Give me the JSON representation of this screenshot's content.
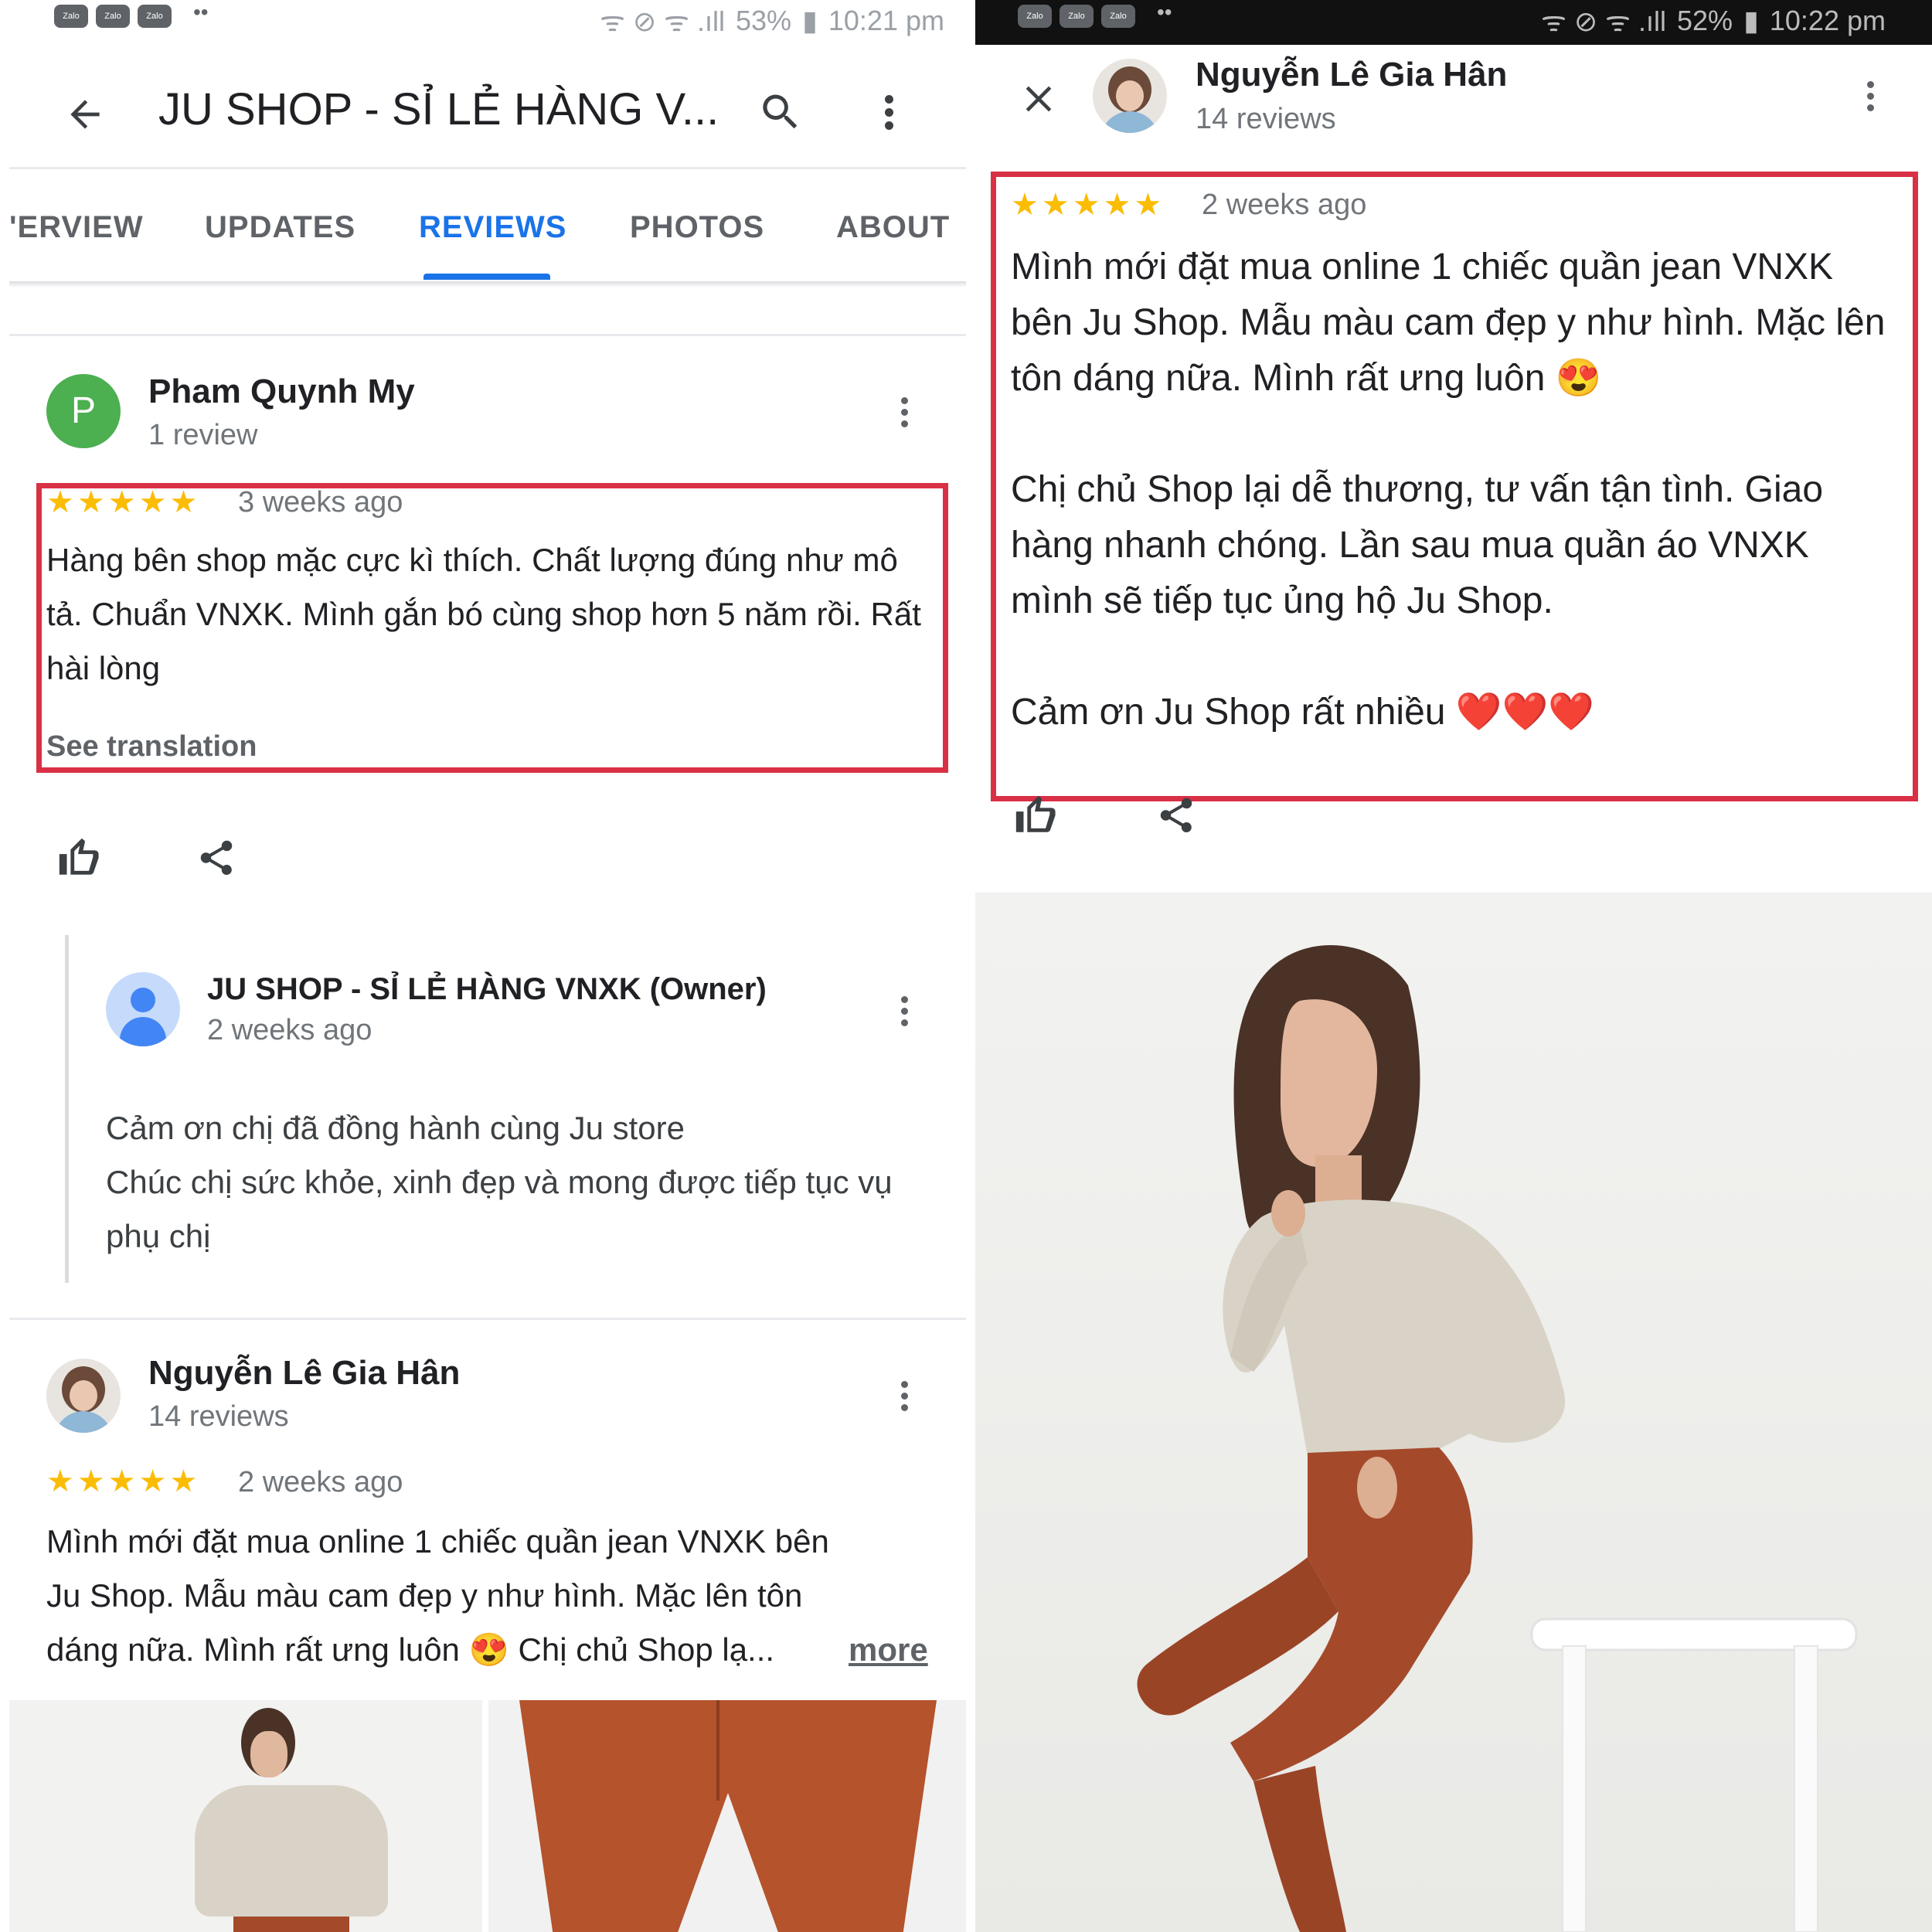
{
  "left": {
    "status": {
      "apps": [
        "Zalo",
        "Zalo",
        "Zalo"
      ],
      "indicators": "ᯤ ⊘ ᯤ .ıll",
      "battery": "53%",
      "time": "10:21 pm"
    },
    "appbar": {
      "title": "JU SHOP - SỈ LẺ HÀNG V..."
    },
    "tabs": [
      {
        "label": "'ERVIEW"
      },
      {
        "label": "UPDATES"
      },
      {
        "label": "REVIEWS"
      },
      {
        "label": "PHOTOS"
      },
      {
        "label": "ABOUT"
      }
    ],
    "active_tab": "REVIEWS",
    "review1": {
      "avatar_letter": "P",
      "author": "Pham Quynh My",
      "count": "1 review",
      "stars": "★★★★★",
      "time": "3 weeks ago",
      "text": "Hàng bên shop mặc cực kì thích. Chất lượng đúng như mô tả. Chuẩn VNXK. Mình gắn bó cùng shop hơn 5 năm rồi. Rất hài lòng",
      "translate": "See translation"
    },
    "owner_reply": {
      "author": "JU SHOP - SỈ LẺ HÀNG VNXK (Owner)",
      "time": "2 weeks ago",
      "text": "Cảm ơn chị đã đồng hành cùng Ju store\nChúc chị sức khỏe, xinh đẹp và mong được tiếp tục vụ phụ chị"
    },
    "review2": {
      "author": "Nguyễn Lê Gia Hân",
      "count": "14 reviews",
      "stars": "★★★★★",
      "time": "2 weeks ago",
      "text": "Mình mới đặt mua online 1 chiếc quần jean VNXK bên Ju Shop. Mẫu màu cam đẹp y như hình. Mặc lên tôn dáng nữa. Mình rất ưng luôn 😍 Chị chủ Shop lạ...",
      "more": "more"
    }
  },
  "right": {
    "status": {
      "apps": [
        "Zalo",
        "Zalo",
        "Zalo"
      ],
      "indicators": "ᯤ ⊘ ᯤ .ıll",
      "battery": "52%",
      "time": "10:22 pm"
    },
    "author": "Nguyễn Lê Gia Hân",
    "count": "14 reviews",
    "stars": "★★★★★",
    "time": "2 weeks ago",
    "text": "Mình mới đặt mua online 1 chiếc quần jean VNXK bên Ju Shop. Mẫu màu cam đẹp y như hình. Mặc lên tôn dáng nữa. Mình rất ưng luôn 😍\n\nChị chủ Shop lại dễ thương, tư vấn tận tình. Giao hàng nhanh chóng. Lần sau mua quần áo VNXK mình sẽ tiếp tục ủng hộ Ju Shop.\n\nCảm ơn Ju Shop rất nhiều ❤️❤️❤️"
  },
  "colors": {
    "accent": "#1a73e8",
    "highlight": "#d93045",
    "star": "#fbbc04",
    "avatar_p": "#4caf50",
    "pants": "#a44a2a",
    "sweater": "#d9d3c7"
  }
}
